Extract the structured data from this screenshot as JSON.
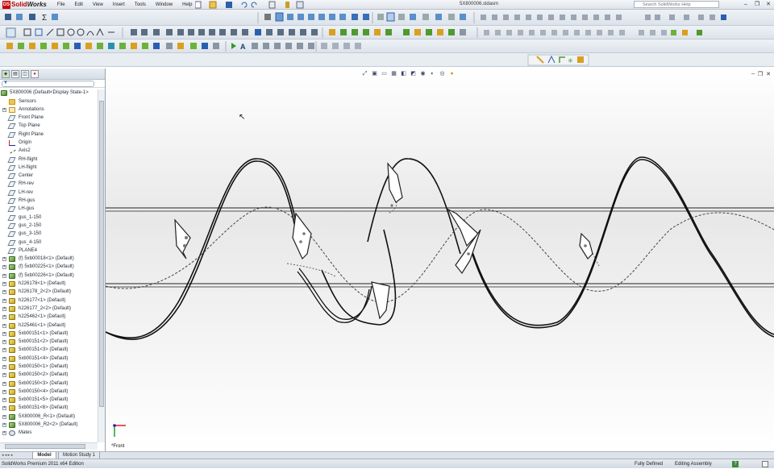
{
  "app": {
    "logo_ds": "DS",
    "logo_text": "Solid",
    "logo_text2": "Works",
    "document_title": "5X800006.sldasm",
    "search_placeholder": "Search SolidWorks Help"
  },
  "menu": [
    "File",
    "Edit",
    "View",
    "Insert",
    "Tools",
    "Window",
    "Help"
  ],
  "window_controls": {
    "minimize": "–",
    "restore": "❐",
    "close": "✕"
  },
  "feature_tree": {
    "root": "5X800006  (Default<Display State-1>",
    "items": [
      {
        "label": "Sensors",
        "icon": "folder",
        "exp": ""
      },
      {
        "label": "Annotations",
        "icon": "annot",
        "exp": "+"
      },
      {
        "label": "Front Plane",
        "icon": "plane",
        "exp": ""
      },
      {
        "label": "Top Plane",
        "icon": "plane",
        "exp": ""
      },
      {
        "label": "Right Plane",
        "icon": "plane",
        "exp": ""
      },
      {
        "label": "Origin",
        "icon": "origin",
        "exp": ""
      },
      {
        "label": "Axis2",
        "icon": "axis",
        "exp": ""
      },
      {
        "label": "RH-flight",
        "icon": "plane",
        "exp": ""
      },
      {
        "label": "LH-flight",
        "icon": "plane",
        "exp": ""
      },
      {
        "label": "Center",
        "icon": "plane",
        "exp": ""
      },
      {
        "label": "RH-rev",
        "icon": "plane",
        "exp": ""
      },
      {
        "label": "LH-rev",
        "icon": "plane",
        "exp": ""
      },
      {
        "label": "RH-gus",
        "icon": "plane",
        "exp": ""
      },
      {
        "label": "LH-gus",
        "icon": "plane",
        "exp": ""
      },
      {
        "label": "gus_1-150",
        "icon": "plane",
        "exp": ""
      },
      {
        "label": "gus_2-150",
        "icon": "plane",
        "exp": ""
      },
      {
        "label": "gus_3-150",
        "icon": "plane",
        "exp": ""
      },
      {
        "label": "gus_4-150",
        "icon": "plane",
        "exp": ""
      },
      {
        "label": "PLANE4",
        "icon": "plane",
        "exp": ""
      },
      {
        "label": "(f) 5xb00018<1> (Default)",
        "icon": "asm",
        "exp": "+"
      },
      {
        "label": "(f) 5xb00225<1> (Default)",
        "icon": "asm",
        "exp": "+"
      },
      {
        "label": "(f) 5xb00226<1> (Default)",
        "icon": "asm",
        "exp": "+"
      },
      {
        "label": "h226178<1> (Default)",
        "icon": "part",
        "exp": "+"
      },
      {
        "label": "h226178_2<2> (Default)",
        "icon": "part",
        "exp": "+"
      },
      {
        "label": "h226177<1> (Default)",
        "icon": "part",
        "exp": "+"
      },
      {
        "label": "h226177_2<2> (Default)",
        "icon": "part",
        "exp": "+"
      },
      {
        "label": "h225462<1> (Default)",
        "icon": "part",
        "exp": "+"
      },
      {
        "label": "h225461<1> (Default)",
        "icon": "part",
        "exp": "+"
      },
      {
        "label": "5xb00151<1> (Default)",
        "icon": "part",
        "exp": "+"
      },
      {
        "label": "5xb00151<2> (Default)",
        "icon": "part",
        "exp": "+"
      },
      {
        "label": "5xb00151<3> (Default)",
        "icon": "part",
        "exp": "+"
      },
      {
        "label": "5xb00151<4> (Default)",
        "icon": "part",
        "exp": "+"
      },
      {
        "label": "5xb00150<1> (Default)",
        "icon": "part",
        "exp": "+"
      },
      {
        "label": "5xb00150<2> (Default)",
        "icon": "part",
        "exp": "+"
      },
      {
        "label": "5xb00150<3> (Default)",
        "icon": "part",
        "exp": "+"
      },
      {
        "label": "5xb00150<4> (Default)",
        "icon": "part",
        "exp": "+"
      },
      {
        "label": "5xb00151<5> (Default)",
        "icon": "part",
        "exp": "+"
      },
      {
        "label": "5xb00151<6> (Default)",
        "icon": "part",
        "exp": "+"
      },
      {
        "label": "5X800006_R<1> (Default)",
        "icon": "asm",
        "exp": "+"
      },
      {
        "label": "5X800006_R2<2> (Default)",
        "icon": "asm",
        "exp": "+"
      },
      {
        "label": "Mates",
        "icon": "mates",
        "exp": "+"
      }
    ]
  },
  "viewport": {
    "view_name": "*Front"
  },
  "bottom_tabs": {
    "nav": "◂ ◂ ▸ ▸",
    "model": "Model",
    "motion": "Motion Study 1"
  },
  "status": {
    "edition": "SolidWorks Premium 2011 x64 Edition",
    "state": "Fully Defined",
    "mode": "Editing Assembly",
    "help": "?"
  }
}
